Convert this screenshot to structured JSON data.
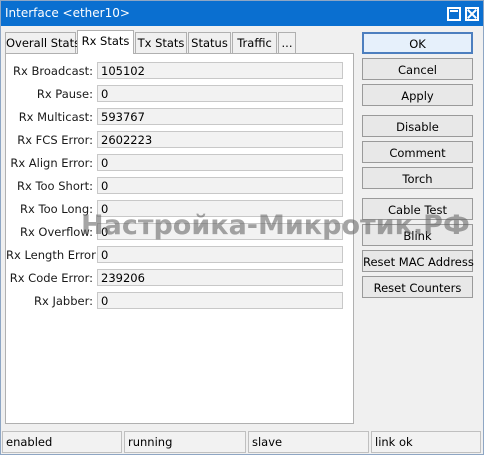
{
  "window": {
    "title": "Interface <ether10>"
  },
  "titlebar_icons": [
    "maximize-icon",
    "close-icon"
  ],
  "tabs": [
    {
      "label": "Overall Stats",
      "active": false
    },
    {
      "label": "Rx Stats",
      "active": true
    },
    {
      "label": "Tx Stats",
      "active": false
    },
    {
      "label": "Status",
      "active": false
    },
    {
      "label": "Traffic",
      "active": false
    },
    {
      "label": "...",
      "active": false
    }
  ],
  "fields": [
    {
      "label": "Rx Broadcast:",
      "value": "105102"
    },
    {
      "label": "Rx Pause:",
      "value": "0"
    },
    {
      "label": "Rx Multicast:",
      "value": "593767"
    },
    {
      "label": "Rx FCS Error:",
      "value": "2602223"
    },
    {
      "label": "Rx Align Error:",
      "value": "0"
    },
    {
      "label": "Rx Too Short:",
      "value": "0"
    },
    {
      "label": "Rx Too Long:",
      "value": "0"
    },
    {
      "label": "Rx Overflow:",
      "value": "0"
    },
    {
      "label": "Rx Length Error:",
      "value": "0"
    },
    {
      "label": "Rx Code Error:",
      "value": "239206"
    },
    {
      "label": "Rx Jabber:",
      "value": "0"
    }
  ],
  "buttons": [
    {
      "label": "OK"
    },
    {
      "label": "Cancel"
    },
    {
      "label": "Apply"
    },
    {
      "label": "Disable"
    },
    {
      "label": "Comment"
    },
    {
      "label": "Torch"
    },
    {
      "label": "Cable Test"
    },
    {
      "label": "Blink"
    },
    {
      "label": "Reset MAC Address"
    },
    {
      "label": "Reset Counters"
    }
  ],
  "status": [
    "enabled",
    "running",
    "slave",
    "link ok"
  ],
  "watermark": "Настройка-Микротик.РФ",
  "colors": {
    "titlebar": "#0a6fd0",
    "default_button_border": "#4d7fbf"
  }
}
